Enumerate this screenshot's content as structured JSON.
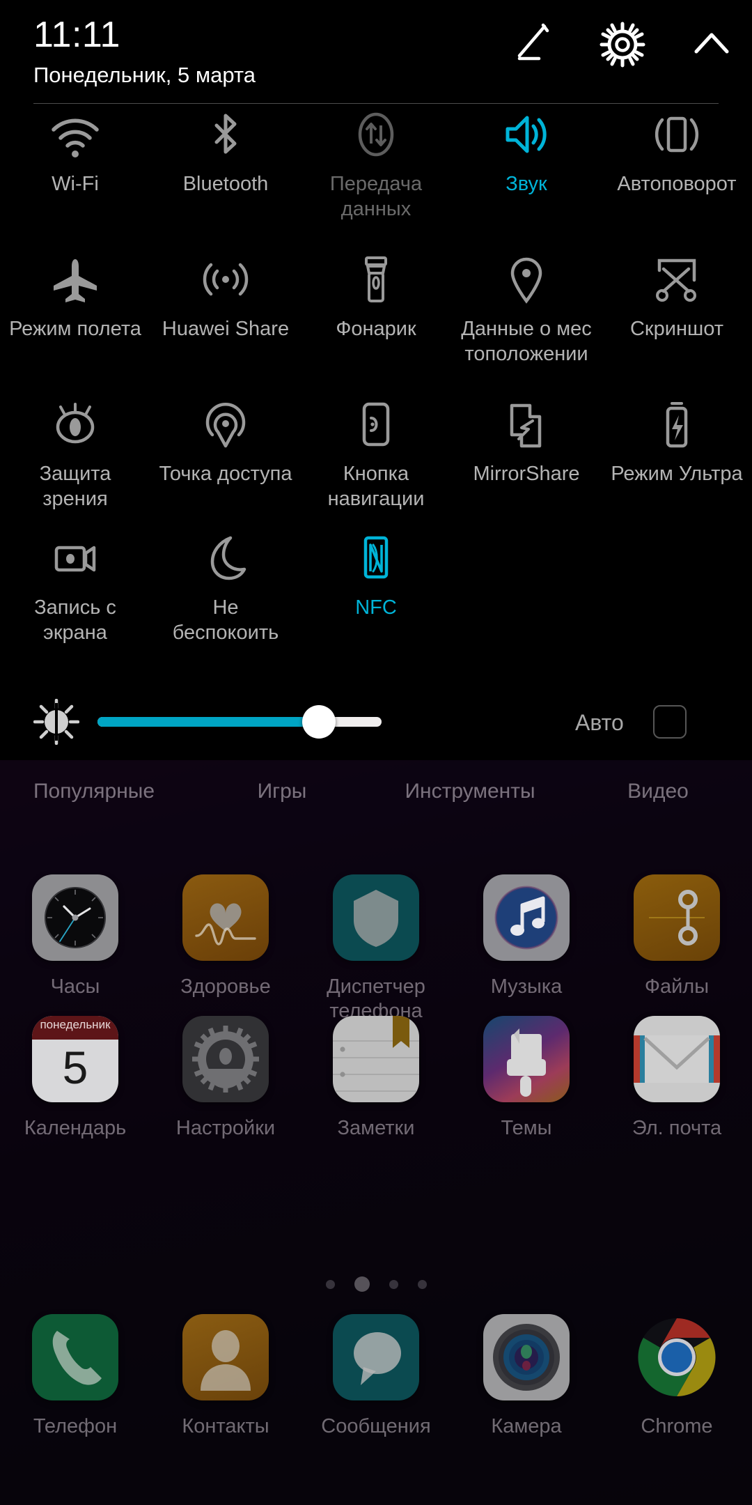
{
  "colors": {
    "accent": "#00b4d8",
    "slider_fill": "#00a5c4",
    "tile_label": "#b4b4b4",
    "tile_label_dim": "#6a6a6a",
    "shade_bg": "#000000"
  },
  "status_shade": {
    "header": {
      "time": "11:11",
      "date": "Понедельник, 5 марта",
      "edit_icon": "pencil-edit-icon",
      "settings_icon": "gear-icon",
      "collapse_icon": "chevron-up-icon"
    },
    "brightness": {
      "icon": "brightness-sun-icon",
      "value_percent": 78,
      "auto_label": "Авто",
      "auto_checked": false
    },
    "tiles": [
      [
        {
          "label": "Wi-Fi",
          "icon": "wifi-icon",
          "state": "off"
        },
        {
          "label": "Bluetooth",
          "icon": "bluetooth-icon",
          "state": "off"
        },
        {
          "label": "Передача данных",
          "icon": "mobile-data-icon",
          "state": "disabled"
        },
        {
          "label": "Звук",
          "icon": "sound-speaker-icon",
          "state": "on"
        },
        {
          "label": "Автоповорот",
          "icon": "auto-rotate-icon",
          "state": "off"
        }
      ],
      [
        {
          "label": "Режим полета",
          "icon": "airplane-icon",
          "state": "off"
        },
        {
          "label": "Huawei Share",
          "icon": "huawei-share-icon",
          "state": "off"
        },
        {
          "label": "Фонарик",
          "icon": "flashlight-icon",
          "state": "off"
        },
        {
          "label": "Данные о мес тоположении",
          "icon": "location-pin-icon",
          "state": "off"
        },
        {
          "label": "Скриншот",
          "icon": "screenshot-scissors-icon",
          "state": "off"
        }
      ],
      [
        {
          "label": "Защита зрения",
          "icon": "eye-comfort-icon",
          "state": "off"
        },
        {
          "label": "Точка доступа",
          "icon": "hotspot-icon",
          "state": "off"
        },
        {
          "label": "Кнопка навигации",
          "icon": "nav-button-icon",
          "state": "off"
        },
        {
          "label": "MirrorShare",
          "icon": "mirrorshare-icon",
          "state": "off"
        },
        {
          "label": "Режим Ультра",
          "icon": "ultra-battery-icon",
          "state": "off"
        }
      ],
      [
        {
          "label": "Запись с экрана",
          "icon": "screen-record-icon",
          "state": "off"
        },
        {
          "label": "Не беспокоить",
          "icon": "moon-dnd-icon",
          "state": "off"
        },
        {
          "label": "NFC",
          "icon": "nfc-icon",
          "state": "on"
        },
        {
          "label": "",
          "icon": "",
          "state": "empty"
        },
        {
          "label": "",
          "icon": "",
          "state": "empty"
        }
      ]
    ]
  },
  "home_screen": {
    "categories": [
      "Популярные",
      "Игры",
      "Инструменты",
      "Видео"
    ],
    "rows": [
      [
        {
          "label": "Часы",
          "icon": "clock-app-icon"
        },
        {
          "label": "Здоровье",
          "icon": "health-heart-app-icon"
        },
        {
          "label": "Диспетчер телефона",
          "icon": "phone-manager-shield-app-icon"
        },
        {
          "label": "Музыка",
          "icon": "music-note-app-icon"
        },
        {
          "label": "Файлы",
          "icon": "files-app-icon"
        }
      ],
      [
        {
          "label": "Календарь",
          "icon": "calendar-app-icon",
          "day_name": "понедельник",
          "day_number": "5"
        },
        {
          "label": "Настройки",
          "icon": "settings-gear-app-icon"
        },
        {
          "label": "Заметки",
          "icon": "notes-app-icon"
        },
        {
          "label": "Темы",
          "icon": "themes-brush-app-icon"
        },
        {
          "label": "Эл. почта",
          "icon": "email-envelope-app-icon"
        }
      ]
    ],
    "page_indicator": {
      "total": 4,
      "active_index": 1
    },
    "dock": [
      {
        "label": "Телефон",
        "icon": "phone-handset-app-icon"
      },
      {
        "label": "Контакты",
        "icon": "contacts-person-app-icon"
      },
      {
        "label": "Сообщения",
        "icon": "messages-bubble-app-icon"
      },
      {
        "label": "Камера",
        "icon": "camera-lens-app-icon"
      },
      {
        "label": "Chrome",
        "icon": "chrome-browser-app-icon"
      }
    ]
  }
}
